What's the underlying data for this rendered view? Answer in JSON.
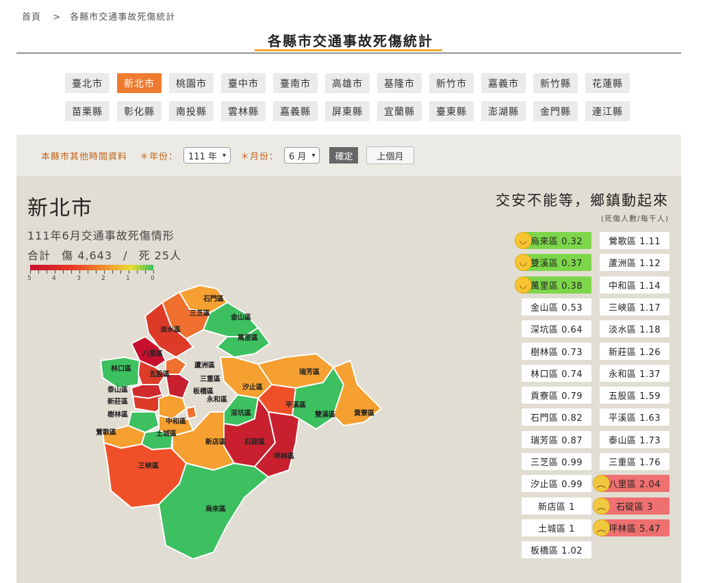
{
  "breadcrumb": {
    "home": "首頁",
    "separator": ">",
    "current": "各縣市交通事故死傷統計"
  },
  "page_title": "各縣市交通事故死傷統計",
  "cities": {
    "row1": [
      "臺北市",
      "新北市",
      "桃園市",
      "臺中市",
      "臺南市",
      "高雄市",
      "基隆市",
      "新竹市",
      "嘉義市",
      "新竹縣",
      "花蓮縣"
    ],
    "row2": [
      "苗栗縣",
      "彰化縣",
      "南投縣",
      "雲林縣",
      "嘉義縣",
      "屏東縣",
      "宜蘭縣",
      "臺東縣",
      "澎湖縣",
      "金門縣",
      "連江縣"
    ],
    "active": "新北市"
  },
  "filter": {
    "label": "本縣市其他時間資料",
    "year_label": "＊年份：",
    "year_value": "111 年",
    "month_label": "＊月份：",
    "month_value": "6 月",
    "confirm": "確定",
    "prev_month": "上個月"
  },
  "summary": {
    "city": "新北市",
    "subtitle": "111年6月交通事故死傷情形",
    "total_label": "合計",
    "injured": "傷 4,643",
    "slash": "/",
    "dead": "死 25人"
  },
  "legend": {
    "labels": [
      "5",
      "4",
      "3",
      "2",
      "1",
      "0"
    ],
    "colors": [
      "#c8102e",
      "#e63a24",
      "#f0a030",
      "#e8dc30",
      "#3cc060"
    ]
  },
  "ranking": {
    "slogan": "交安不能等，鄉鎮動起來",
    "unit": "(死傷人數/每千人)",
    "left": [
      {
        "label": "烏來區 0.32",
        "status": "good"
      },
      {
        "label": "雙溪區 0.37",
        "status": "good"
      },
      {
        "label": "萬里區 0.38",
        "status": "good"
      },
      {
        "label": "金山區 0.53",
        "status": "normal"
      },
      {
        "label": "深坑區 0.64",
        "status": "normal"
      },
      {
        "label": "樹林區 0.73",
        "status": "normal"
      },
      {
        "label": "林口區 0.74",
        "status": "normal"
      },
      {
        "label": "貢寮區 0.79",
        "status": "normal"
      },
      {
        "label": "石門區 0.82",
        "status": "normal"
      },
      {
        "label": "瑞芳區 0.87",
        "status": "normal"
      },
      {
        "label": "三芝區 0.99",
        "status": "normal"
      },
      {
        "label": "汐止區 0.99",
        "status": "normal"
      },
      {
        "label": "新店區 1",
        "status": "normal"
      },
      {
        "label": "土城區 1",
        "status": "normal"
      },
      {
        "label": "板橋區 1.02",
        "status": "normal"
      }
    ],
    "right": [
      {
        "label": "鶯歌區 1.11",
        "status": "normal"
      },
      {
        "label": "蘆洲區 1.12",
        "status": "normal"
      },
      {
        "label": "中和區 1.14",
        "status": "normal"
      },
      {
        "label": "三峽區 1.17",
        "status": "normal"
      },
      {
        "label": "淡水區 1.18",
        "status": "normal"
      },
      {
        "label": "新莊區 1.26",
        "status": "normal"
      },
      {
        "label": "永和區 1.37",
        "status": "normal"
      },
      {
        "label": "五股區 1.59",
        "status": "normal"
      },
      {
        "label": "平溪區 1.63",
        "status": "normal"
      },
      {
        "label": "泰山區 1.73",
        "status": "normal"
      },
      {
        "label": "三重區 1.76",
        "status": "normal"
      },
      {
        "label": "八里區 2.04",
        "status": "bad"
      },
      {
        "label": "石碇區 3",
        "status": "bad"
      },
      {
        "label": "坪林區 5.47",
        "status": "bad"
      }
    ]
  },
  "map": {
    "districts": [
      {
        "name": "石門區",
        "color": "#f5a030"
      },
      {
        "name": "三芝區",
        "color": "#f07030"
      },
      {
        "name": "淡水區",
        "color": "#dd3a28"
      },
      {
        "name": "金山區",
        "color": "#3cc060"
      },
      {
        "name": "萬里區",
        "color": "#3cc060"
      },
      {
        "name": "八里區",
        "color": "#c8102e"
      },
      {
        "name": "林口區",
        "color": "#3cc060"
      },
      {
        "name": "五股區",
        "color": "#dd3a28"
      },
      {
        "name": "蘆洲區",
        "color": "#f07030"
      },
      {
        "name": "三重區",
        "color": "#c8202e"
      },
      {
        "name": "泰山區",
        "color": "#d02a2e"
      },
      {
        "name": "新莊區",
        "color": "#dd3a28"
      },
      {
        "name": "樹林區",
        "color": "#3cc060"
      },
      {
        "name": "板橋區",
        "color": "#f5a030"
      },
      {
        "name": "永和區",
        "color": "#f07030"
      },
      {
        "name": "中和區",
        "color": "#f5a030"
      },
      {
        "name": "鶯歌區",
        "color": "#f5a030"
      },
      {
        "name": "土城區",
        "color": "#3cc060"
      },
      {
        "name": "汐止區",
        "color": "#f5a030"
      },
      {
        "name": "瑞芳區",
        "color": "#f5a030"
      },
      {
        "name": "平溪區",
        "color": "#f05028"
      },
      {
        "name": "雙溪區",
        "color": "#3cc060"
      },
      {
        "name": "貢寮區",
        "color": "#f5a030"
      },
      {
        "name": "深坑區",
        "color": "#3cc060"
      },
      {
        "name": "石碇區",
        "color": "#c8202e"
      },
      {
        "name": "坪林區",
        "color": "#c8202e"
      },
      {
        "name": "新店區",
        "color": "#f5a030"
      },
      {
        "name": "三峽區",
        "color": "#f05028"
      },
      {
        "name": "烏來區",
        "color": "#3cc060"
      }
    ]
  }
}
